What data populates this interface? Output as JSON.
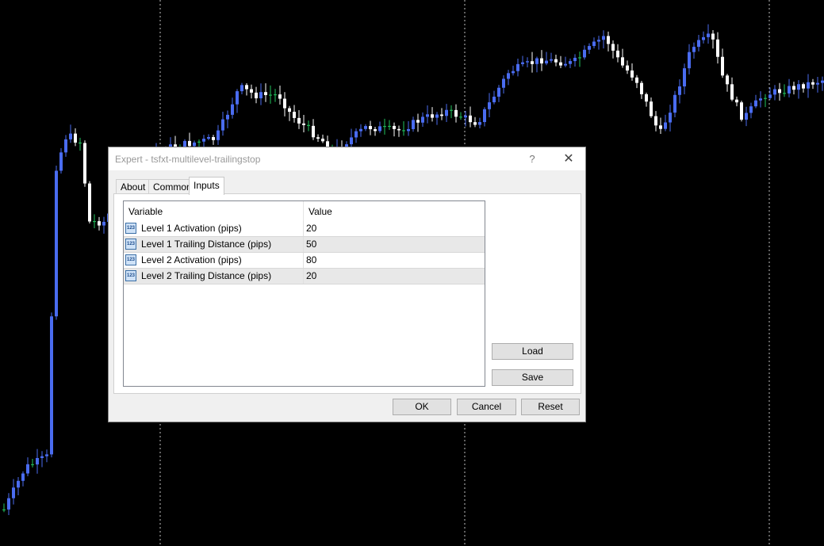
{
  "dialog": {
    "title": "Expert - tsfxt-multilevel-trailingstop",
    "help_label": "?",
    "close_label": "✕"
  },
  "tabs": [
    {
      "label": "About",
      "active": false
    },
    {
      "label": "Common",
      "active": false
    },
    {
      "label": "Inputs",
      "active": true
    }
  ],
  "grid": {
    "columns": [
      "Variable",
      "Value"
    ],
    "rows": [
      {
        "icon": "integer-type-icon",
        "icon_text": "123",
        "variable": "Level 1 Activation (pips)",
        "value": "20"
      },
      {
        "icon": "integer-type-icon",
        "icon_text": "123",
        "variable": "Level 1 Trailing Distance (pips)",
        "value": "50"
      },
      {
        "icon": "integer-type-icon",
        "icon_text": "123",
        "variable": "Level 2 Activation (pips)",
        "value": "80"
      },
      {
        "icon": "integer-type-icon",
        "icon_text": "123",
        "variable": "Level 2 Trailing Distance (pips)",
        "value": "20"
      }
    ]
  },
  "side_buttons": {
    "load": "Load",
    "save": "Save"
  },
  "footer_buttons": {
    "ok": "OK",
    "cancel": "Cancel",
    "reset": "Reset"
  },
  "colors": {
    "chart_background": "#000000",
    "bull_candle": "#4a6cf0",
    "bear_candle": "#ffffff",
    "doji_candle": "#22c55e",
    "grid_line": "#ffffff"
  }
}
